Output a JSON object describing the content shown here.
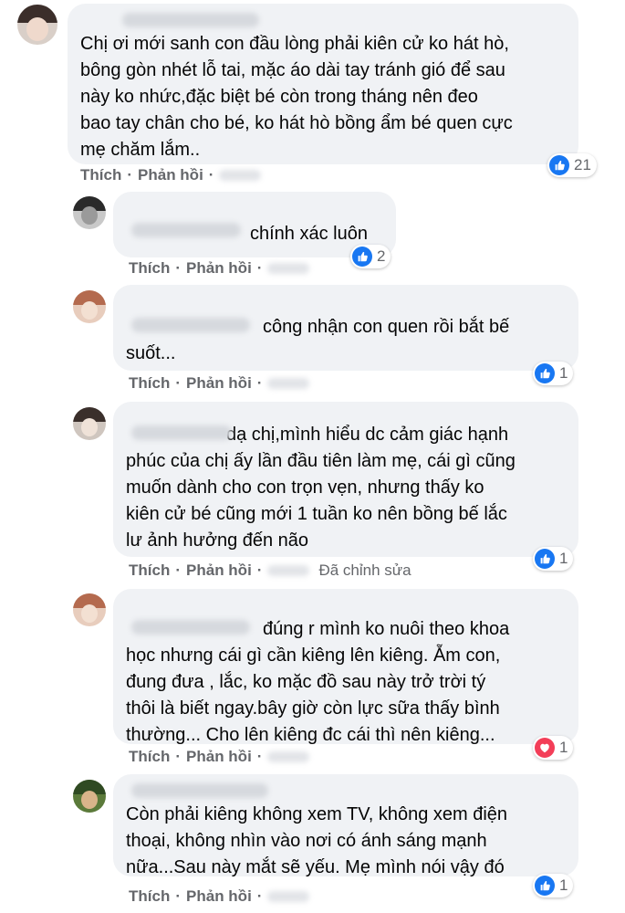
{
  "colors": {
    "bubble": "#f0f2f5",
    "text": "#050505",
    "secondary": "#65676b",
    "like": "#1877f2",
    "love": "#f33e58"
  },
  "actions": {
    "like_label": "Thích",
    "reply_label": "Phản hồi",
    "separator": "·"
  },
  "comments": [
    {
      "text_lines": [
        "Chị ơi mới sanh con đầu lòng phải kiên cử ko hát hò,",
        "bông gòn nhét lỗ tai, mặc áo dài tay tránh gió để sau",
        "này ko nhức,đặc biệt bé còn trong tháng nên đeo",
        "bao tay chân cho bé, ko hát hò bồng ẩm bé quen cực",
        "mẹ chăm lắm.."
      ],
      "reaction_icon": "like-icon",
      "reaction_count": "21"
    },
    {
      "text_lines": [
        "chính xác luôn"
      ],
      "reaction_icon": "like-icon",
      "reaction_count": "2"
    },
    {
      "text_lines": [
        "công nhận con quen rồi bắt bế",
        "suốt..."
      ],
      "reaction_icon": "like-icon",
      "reaction_count": "1"
    },
    {
      "text_lines": [
        "dạ chị,mình hiểu dc cảm giác hạnh",
        "phúc của chị ấy lần đầu tiên làm mẹ, cái gì cũng",
        "muốn dành cho con trọn vẹn, nhưng thấy ko",
        "kiên cử bé cũng mới 1 tuần ko nên bồng bế lắc",
        "lư ảnh hưởng đến não"
      ],
      "edited_label": "Đã chỉnh sửa",
      "reaction_icon": "like-icon",
      "reaction_count": "1"
    },
    {
      "text_lines": [
        "đúng r mình ko nuôi theo khoa",
        "học nhưng cái gì cần kiêng lên kiêng. Ẵm con,",
        "đung đưa , lắc, ko mặc đồ sau này trở trời tý",
        "thôi là biết ngay.bây giờ còn lực sữa thấy bình",
        "thường... Cho lên kiêng đc cái thì nên kiêng..."
      ],
      "reaction_icon": "heart-icon",
      "reaction_count": "1"
    },
    {
      "text_lines": [
        "Còn phải kiêng không xem TV, không xem điện",
        "thoại, không nhìn vào nơi có ánh sáng mạnh",
        "nữa...Sau này mắt sẽ yếu. Mẹ mình nói vậy đó"
      ],
      "reaction_icon": "like-icon",
      "reaction_count": "1"
    }
  ]
}
